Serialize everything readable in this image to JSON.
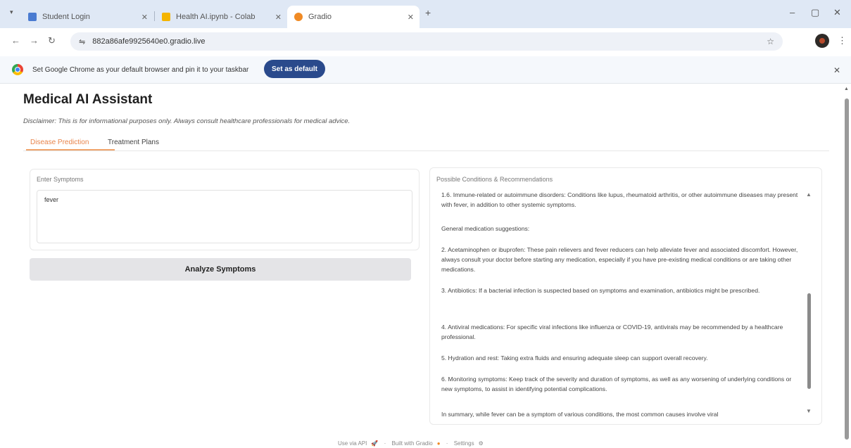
{
  "browser": {
    "tabs": [
      {
        "title": "Student Login",
        "favicon_color": "#4a7bd1"
      },
      {
        "title": "Health AI.ipynb - Colab",
        "favicon_color": "#f4b400"
      },
      {
        "title": "Gradio",
        "favicon_color": "#f08a24"
      }
    ],
    "new_tab_glyph": "+",
    "window_controls": [
      "–",
      "▢",
      "✕"
    ],
    "url": "882a86afe9925640e0.gradio.live",
    "infobar": {
      "message": "Set Google Chrome as your default browser and pin it to your taskbar",
      "button_label": "Set as default",
      "close": "✕"
    }
  },
  "app": {
    "title": "Medical AI Assistant",
    "disclaimer": "Disclaimer: This is for informational purposes only. Always consult healthcare professionals for medical advice.",
    "tabs": [
      {
        "label": "Disease Prediction",
        "active": true
      },
      {
        "label": "Treatment Plans",
        "active": false
      }
    ],
    "input": {
      "label": "Enter Symptoms",
      "value": "fever"
    },
    "analyze_label": "Analyze Symptoms",
    "output": {
      "label": "Possible Conditions & Recommendations",
      "paragraphs": [
        "1.6. Immune-related or autoimmune disorders: Conditions like lupus, rheumatoid arthritis, or other autoimmune diseases may present with fever, in addition to other systemic symptoms.",
        "General medication suggestions:",
        "2. Acetaminophen or ibuprofen: These pain relievers and fever reducers can help alleviate fever and associated discomfort. However, always consult your doctor before starting any medication, especially if you have pre-existing medical conditions or are taking other medications.",
        "3. Antibiotics: If a bacterial infection is suspected based on symptoms and examination, antibiotics might be prescribed.",
        "4. Antiviral medications: For specific viral infections like influenza or COVID-19, antivirals may be recommended by a healthcare professional.",
        "5. Hydration and rest: Taking extra fluids and ensuring adequate sleep can support overall recovery.",
        "6. Monitoring symptoms: Keep track of the severity and duration of symptoms, as well as any worsening of underlying conditions or new symptoms, to assist in identifying potential complications.",
        "In summary, while fever can be a symptom of various conditions, the most common causes involve viral"
      ]
    },
    "footer": {
      "api": "Use via API",
      "built": "Built with Gradio",
      "settings": "Settings"
    }
  }
}
